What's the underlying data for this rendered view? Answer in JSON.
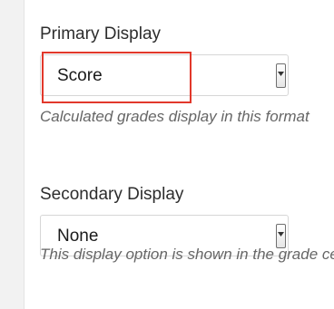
{
  "primary_display": {
    "label": "Primary Display",
    "selected_value": "Score",
    "help_text": "Calculated grades display in this format",
    "arrow_icon": "dropdown-arrow-icon"
  },
  "secondary_display": {
    "label": "Secondary Display",
    "selected_value": "None",
    "help_text": "This display option is shown in the grade center",
    "arrow_icon": "dropdown-arrow-icon"
  },
  "highlight_color": "#e2382b"
}
